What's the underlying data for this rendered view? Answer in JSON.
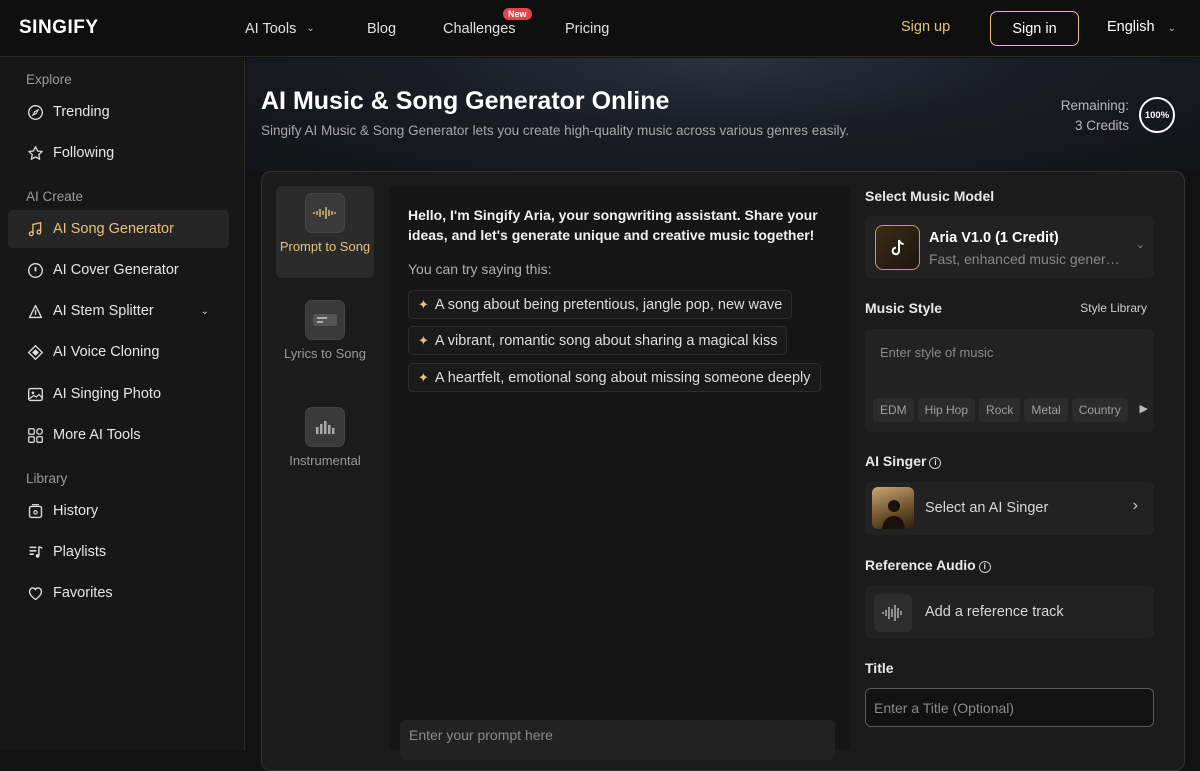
{
  "brand": {
    "logo": "SINGIFY"
  },
  "topnav": {
    "ai_tools": "AI Tools",
    "blog": "Blog",
    "challenges": "Challenges",
    "challenges_badge": "New",
    "pricing": "Pricing",
    "signup": "Sign up",
    "signin": "Sign in",
    "language": "English"
  },
  "sidebar": {
    "explore_title": "Explore",
    "explore": [
      "Trending",
      "Following"
    ],
    "create_title": "AI Create",
    "create": [
      "AI Song Generator",
      "AI Cover Generator",
      "AI Stem Splitter",
      "AI Voice Cloning",
      "AI Singing Photo",
      "More AI Tools"
    ],
    "library_title": "Library",
    "library": [
      "History",
      "Playlists",
      "Favorites"
    ]
  },
  "hero": {
    "title": "AI Music & Song Generator Online",
    "subtitle": "Singify AI Music & Song Generator lets you create high-quality music across various genres easily.",
    "remaining_label": "Remaining:",
    "remaining_value": "3 Credits",
    "credits_percent": "100%"
  },
  "modes": [
    {
      "label": "Prompt to Song",
      "active": true
    },
    {
      "label": "Lyrics to Song",
      "active": false
    },
    {
      "label": "Instrumental",
      "active": false
    }
  ],
  "chat": {
    "greeting": "Hello, I'm Singify Aria, your songwriting assistant. Share your ideas, and let's generate unique and creative music together!",
    "try_saying": "You can try saying this:",
    "suggestions": [
      "A song about being pretentious, jangle pop, new wave",
      "A vibrant, romantic song about sharing a magical kiss",
      "A heartfelt, emotional song about missing someone deeply"
    ],
    "prompt_placeholder": "Enter your prompt here"
  },
  "settings": {
    "model_label": "Select Music Model",
    "model_name": "Aria V1.0 (1 Credit)",
    "model_desc": "Fast, enhanced music generation",
    "style_label": "Music Style",
    "style_library": "Style Library",
    "style_placeholder": "Enter style of music",
    "style_tags": [
      "EDM",
      "Hip Hop",
      "Rock",
      "Metal",
      "Country"
    ],
    "singer_label": "AI Singer",
    "singer_select": "Select an AI Singer",
    "reference_label": "Reference Audio",
    "reference_add": "Add a reference track",
    "title_label": "Title",
    "title_placeholder": "Enter a Title (Optional)"
  },
  "colors": {
    "accent": "#e8c17a",
    "background": "#121212",
    "badge": "#e5434f"
  }
}
